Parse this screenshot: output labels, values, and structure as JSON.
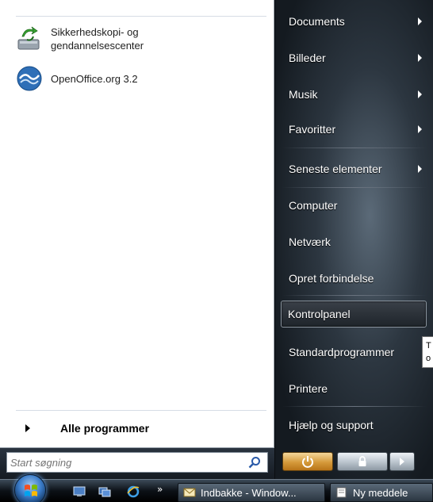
{
  "start_menu": {
    "pinned_programs": [
      {
        "label_line1": "Sikkerhedskopi- og",
        "label_line2": "gendannelsescenter",
        "icon": "backup-restore-icon"
      },
      {
        "label_line1": "OpenOffice.org 3.2",
        "label_line2": "",
        "icon": "openoffice-icon"
      }
    ],
    "all_programs_label": "Alle programmer",
    "search_placeholder": "Start søgning",
    "right_items": [
      {
        "label": "Documents",
        "has_submenu": true
      },
      {
        "label": "Billeder",
        "has_submenu": true
      },
      {
        "label": "Musik",
        "has_submenu": true
      },
      {
        "label": "Favoritter",
        "has_submenu": true
      },
      {
        "label": "Seneste elementer",
        "has_submenu": true
      },
      {
        "label": "Computer",
        "has_submenu": false
      },
      {
        "label": "Netværk",
        "has_submenu": false
      },
      {
        "label": "Opret forbindelse",
        "has_submenu": false
      },
      {
        "label": "Kontrolpanel",
        "has_submenu": false,
        "highlighted": true
      },
      {
        "label": "Standardprogrammer",
        "has_submenu": false
      },
      {
        "label": "Printere",
        "has_submenu": false
      },
      {
        "label": "Hjælp og support",
        "has_submenu": false
      }
    ],
    "tooltip_text": "T o"
  },
  "taskbar": {
    "quick_launch_icons": [
      "show-desktop-icon",
      "switch-windows-icon",
      "internet-explorer-icon"
    ],
    "overflow_chevron": "»",
    "buttons": [
      {
        "label": "Indbakke - Window...",
        "icon": "mail-icon"
      },
      {
        "label": "Ny meddele",
        "icon": "new-message-icon"
      }
    ]
  },
  "colors": {
    "power_button": "#d59a3a",
    "lock_button": "#b9c3cc",
    "left_panel_bg": "#ffffff",
    "right_panel_bg": "#1c232b"
  }
}
